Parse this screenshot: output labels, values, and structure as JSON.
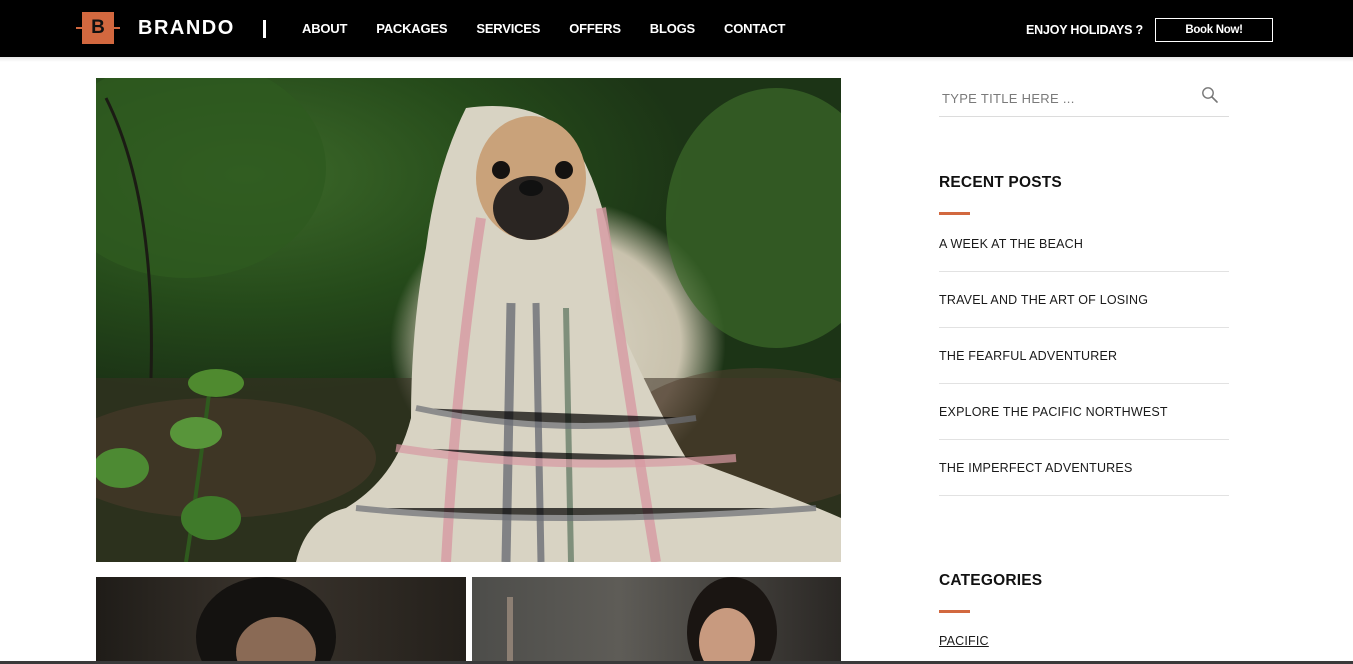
{
  "header": {
    "brand_letter": "B",
    "brand_name": "BRANDO",
    "nav": [
      "ABOUT",
      "PACKAGES",
      "SERVICES",
      "OFFERS",
      "BLOGS",
      "CONTACT"
    ],
    "tagline": "ENJOY HOLIDAYS ?",
    "book_label": "Book Now!"
  },
  "search": {
    "placeholder": "TYPE TITLE HERE ..."
  },
  "recent_posts": {
    "title": "RECENT POSTS",
    "items": [
      "A WEEK AT THE BEACH",
      "TRAVEL AND THE ART OF LOSING",
      "THE FEARFUL ADVENTURER",
      "EXPLORE THE PACIFIC NORTHWEST",
      "THE IMPERFECT ADVENTURES"
    ]
  },
  "categories": {
    "title": "CATEGORIES",
    "items": [
      "PACIFIC"
    ]
  },
  "colors": {
    "accent": "#d2683f",
    "header_bg": "#000000"
  },
  "icons": {
    "search": "search-icon"
  }
}
